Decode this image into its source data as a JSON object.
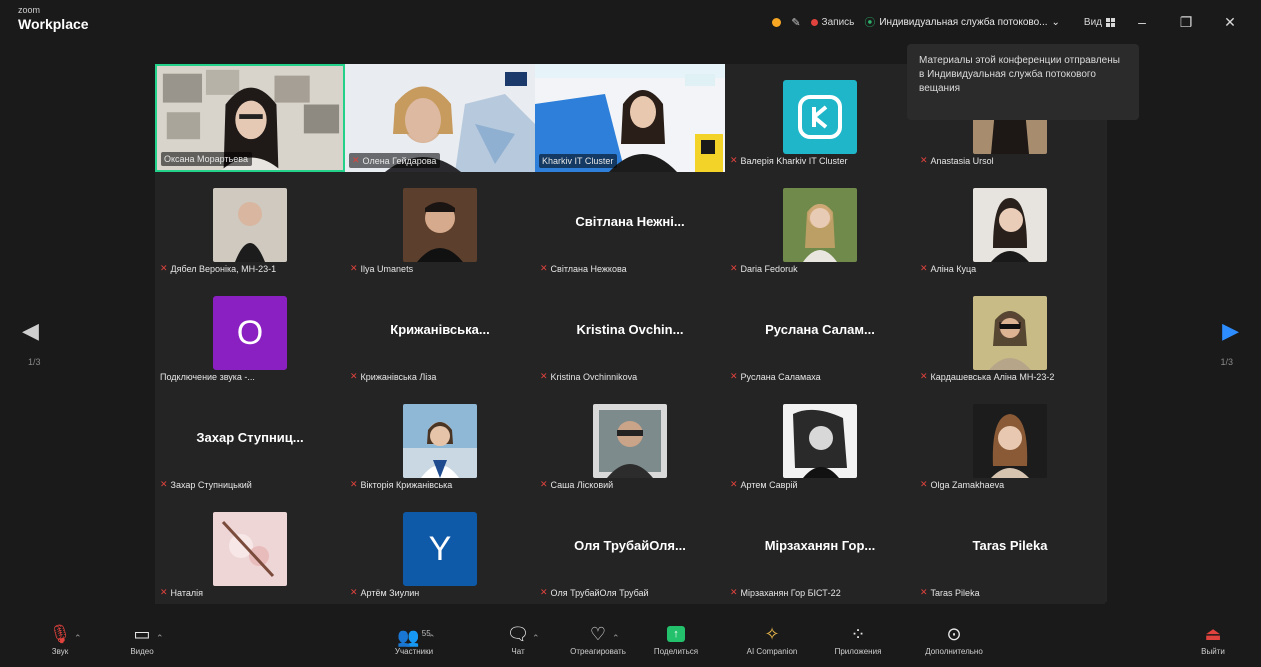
{
  "app": {
    "brand_small": "zoom",
    "brand_name": "Workplace"
  },
  "topbar": {
    "recording_label": "Запись",
    "stream_label": "Индивидуальная служба потоково...",
    "view_label": "Вид",
    "icons": [
      "shield-icon",
      "mic-slash-icon",
      "record-dot-icon",
      "stream-icon",
      "grid-icon",
      "minimize-icon",
      "restore-icon",
      "close-icon"
    ]
  },
  "tooltip": {
    "text": "Материалы этой конференции отправлены в Индивидуальная служба потокового вещания"
  },
  "navigation": {
    "page_left": "1/3",
    "page_right": "1/3"
  },
  "participants": [
    {
      "name": "Оксана Морартьева",
      "kind": "video",
      "active": true,
      "muted": false
    },
    {
      "name": "Олена Гейдарова",
      "kind": "video",
      "active": false,
      "muted": true
    },
    {
      "name": "Kharkiv IT Cluster",
      "kind": "video",
      "active": false,
      "muted": false
    },
    {
      "name": "Валерія Kharkiv IT Cluster",
      "kind": "logo",
      "muted": true
    },
    {
      "name": "Anastasia Ursol",
      "kind": "avatar",
      "muted": true
    },
    {
      "name": "Дябел Вероніка, МН-23-1",
      "kind": "avatar",
      "muted": true
    },
    {
      "name": "Ilya Umanets",
      "kind": "avatar",
      "muted": true
    },
    {
      "name": "Світлана Нежкова",
      "kind": "name",
      "display": "Світлана Нежні...",
      "muted": true
    },
    {
      "name": "Daria Fedoruk",
      "kind": "avatar",
      "muted": true
    },
    {
      "name": "Аліна Куца",
      "kind": "avatar",
      "muted": true
    },
    {
      "name": "Подключение звука -...",
      "kind": "letter",
      "letter": "O",
      "muted": false
    },
    {
      "name": "Крижанівська Ліза",
      "kind": "name",
      "display": "Крижанівська...",
      "muted": true
    },
    {
      "name": "Kristina Ovchinnikova",
      "kind": "name",
      "display": "Kristina Ovchin...",
      "muted": true
    },
    {
      "name": "Руслана Саламаха",
      "kind": "name",
      "display": "Руслана Салам...",
      "muted": true
    },
    {
      "name": "Кардашевська Аліна МН-23-2",
      "kind": "avatar",
      "muted": true
    },
    {
      "name": "Захар Ступницький",
      "kind": "name",
      "display": "Захар Ступниц...",
      "muted": true
    },
    {
      "name": "Вікторія Крижанівська",
      "kind": "avatar",
      "muted": true
    },
    {
      "name": "Саша Лісковий",
      "kind": "avatar",
      "muted": true
    },
    {
      "name": "Артем Саврій",
      "kind": "avatar",
      "muted": true
    },
    {
      "name": "Olga Zamakhaeva",
      "kind": "avatar",
      "muted": true
    },
    {
      "name": "Наталія",
      "kind": "avatar",
      "muted": true
    },
    {
      "name": "Артём Зиулин",
      "kind": "letter",
      "letter": "Y",
      "muted": true
    },
    {
      "name": "Оля ТрубайОля Трубай",
      "kind": "name",
      "display": "Оля ТрубайОля...",
      "muted": true
    },
    {
      "name": "Мірзаханян Гор БІСТ-22",
      "kind": "name",
      "display": "Мірзаханян Гор...",
      "muted": true
    },
    {
      "name": "Taras Pileka",
      "kind": "name",
      "display": "Taras Pileka",
      "muted": true
    }
  ],
  "toolbar": {
    "audio": "Звук",
    "video": "Видео",
    "participants": "Участники",
    "participants_count": "55",
    "chat": "Чат",
    "react": "Отреагировать",
    "share": "Поделиться",
    "ai": "AI Companion",
    "apps": "Приложения",
    "more": "Дополнительно",
    "leave": "Выйти"
  },
  "colors": {
    "accent_blue": "#2d8cff",
    "active_border": "#23d18b",
    "muted_red": "#e0423d",
    "letter_purple": "#8a1fc2",
    "letter_blue": "#0e5aa8"
  }
}
